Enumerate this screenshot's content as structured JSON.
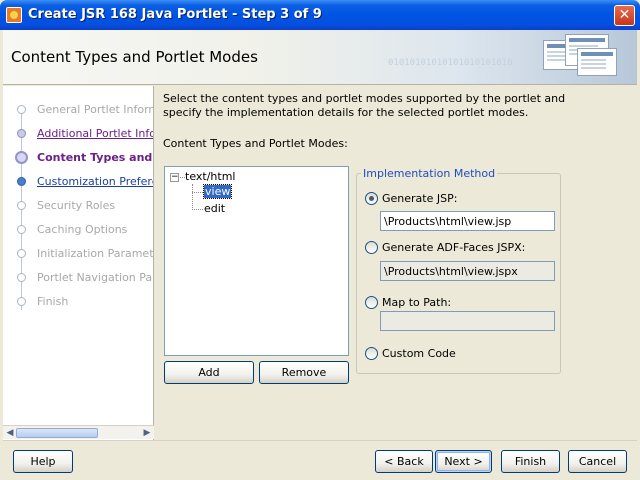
{
  "window": {
    "title": "Create JSR 168 Java Portlet - Step 3 of 9",
    "close_symbol": "✕"
  },
  "header": {
    "title": "Content Types and Portlet Modes",
    "binary_text": "01010101010101010101010"
  },
  "steps": [
    {
      "label": "General Portlet Information",
      "state": "pending"
    },
    {
      "label": "Additional Portlet Information",
      "state": "visited"
    },
    {
      "label": "Content Types and Portlet Modes",
      "state": "current"
    },
    {
      "label": "Customization Preferences",
      "state": "link"
    },
    {
      "label": "Security Roles",
      "state": "pending"
    },
    {
      "label": "Caching Options",
      "state": "pending"
    },
    {
      "label": "Initialization Parameters",
      "state": "pending"
    },
    {
      "label": "Portlet Navigation Parameters",
      "state": "pending"
    },
    {
      "label": "Finish",
      "state": "pending"
    }
  ],
  "main": {
    "description": "Select the content types and portlet modes supported by the portlet and specify the implementation details for the selected portlet modes.",
    "tree_label": "Content Types and Portlet Modes:",
    "tree": {
      "root": "text/html",
      "expander": "−",
      "children": [
        "view",
        "edit"
      ],
      "selected": "view"
    },
    "add_button": "Add",
    "remove_button": "Remove",
    "implementation": {
      "legend": "Implementation Method",
      "options": [
        {
          "label": "Generate JSP:",
          "value": "\\Products\\html\\view.jsp",
          "checked": true
        },
        {
          "label": "Generate ADF-Faces JSPX:",
          "value": "\\Products\\html\\view.jspx",
          "checked": false
        },
        {
          "label": "Map to Path:",
          "value": "",
          "checked": false
        },
        {
          "label": "Custom Code",
          "checked": false
        }
      ]
    }
  },
  "footer": {
    "help": "Help",
    "back": "< Back",
    "next": "Next >",
    "finish": "Finish",
    "cancel": "Cancel"
  }
}
